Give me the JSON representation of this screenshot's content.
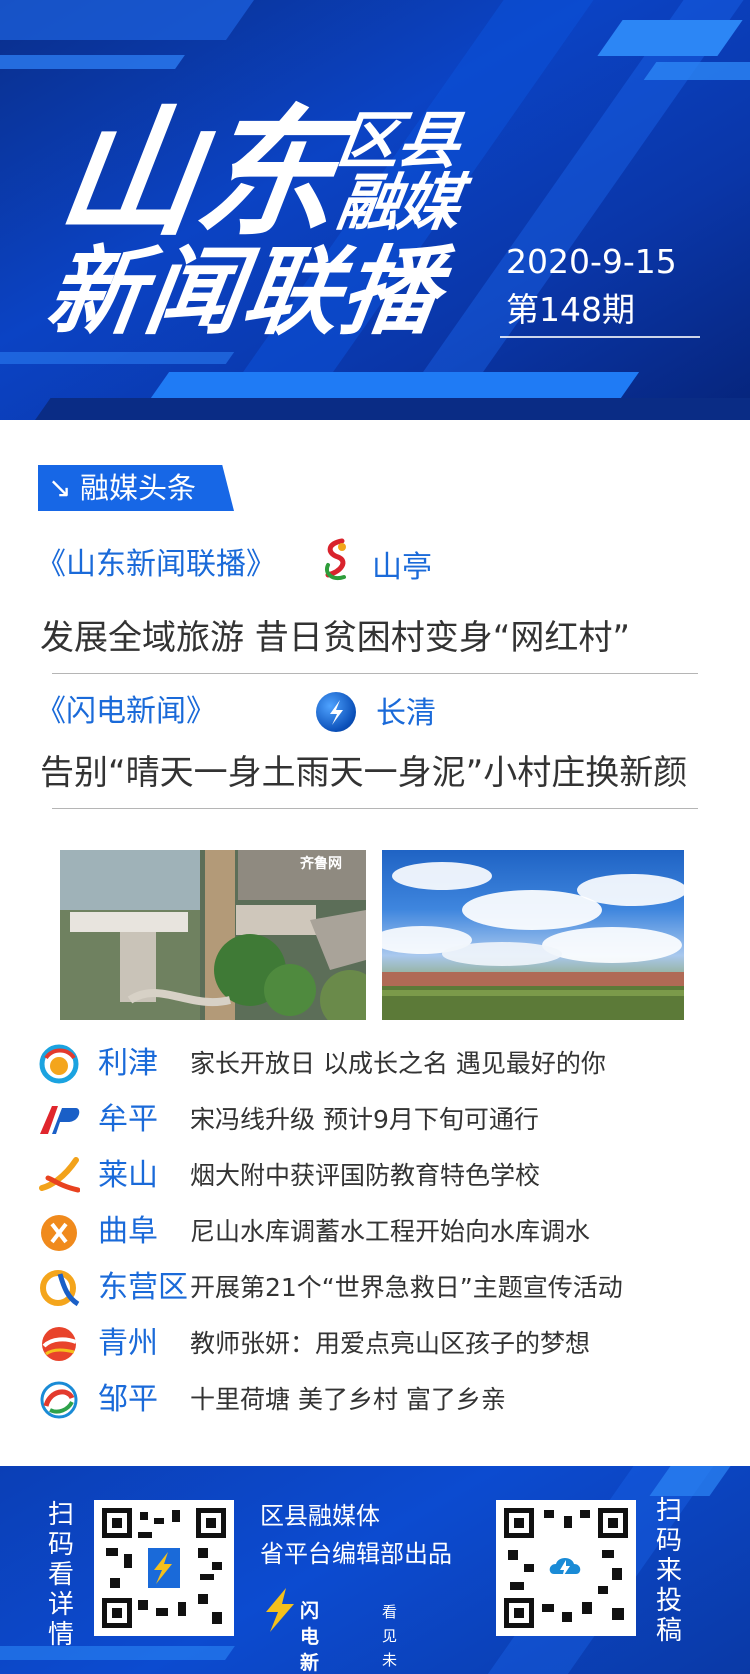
{
  "header": {
    "title_shandong": "山东",
    "title_quxian": "区县",
    "title_rongmei": "融媒",
    "title_xinwen": "新闻联播",
    "date": "2020-9-15",
    "issue": "第148期"
  },
  "section": {
    "label": "融媒头条",
    "icon": "arrow-down-right-icon"
  },
  "headlines": [
    {
      "show": "《山东新闻联播》",
      "county": "山亭",
      "title": "发展全域旅游  昔日贫困村变身“网红村”"
    },
    {
      "show": "《闪电新闻》",
      "county": "长清",
      "title": "告别“晴天一身土雨天一身泥”小村庄换新颜"
    }
  ],
  "photos": {
    "left_watermark": "齐鲁网"
  },
  "news": [
    {
      "county": "利津",
      "text": "家长开放日 以成长之名 遇见最好的你",
      "icon": "lijin-logo-icon"
    },
    {
      "county": "牟平",
      "text": "宋冯线升级 预计9月下旬可通行",
      "icon": "muping-logo-icon"
    },
    {
      "county": "莱山",
      "text": "烟大附中获评国防教育特色学校",
      "icon": "laishan-logo-icon"
    },
    {
      "county": "曲阜",
      "text": "尼山水库调蓄水工程开始向水库调水",
      "icon": "qufu-logo-icon"
    },
    {
      "county": "东营区",
      "text": "开展第21个“世界急救日”主题宣传活动",
      "icon": "dongying-logo-icon"
    },
    {
      "county": "青州",
      "text": "教师张妍：用爱点亮山区孩子的梦想",
      "icon": "qingzhou-logo-icon"
    },
    {
      "county": "邹平",
      "text": "十里荷塘 美了乡村 富了乡亲",
      "icon": "zouping-logo-icon"
    }
  ],
  "footer": {
    "left_vertical": "扫码看详情",
    "right_vertical": "扫码来投稿",
    "brand_line1": "区县融媒体",
    "brand_line2": "省平台编辑部出品",
    "app_name": "闪电新闻",
    "slogan": "看见未来"
  },
  "colors": {
    "brand_blue": "#0b43c4",
    "accent_blue": "#1767e6",
    "link_blue": "#1a6ad9"
  }
}
